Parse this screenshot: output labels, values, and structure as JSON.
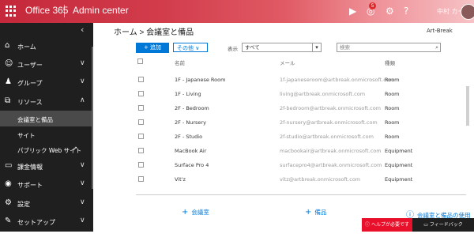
{
  "header": {
    "brand": "Office 365",
    "app_title": "Admin center",
    "notification_count": "5",
    "user_name": "中村 カー"
  },
  "sidebar": {
    "collapse_icon": "chevron-left-icon",
    "items": [
      {
        "label": "ホーム",
        "icon": "home-icon"
      },
      {
        "label": "ユーザー",
        "icon": "person-icon"
      },
      {
        "label": "グループ",
        "icon": "group-icon"
      },
      {
        "label": "リソース",
        "icon": "resources-icon"
      },
      {
        "label": "会議室と備品"
      },
      {
        "label": "サイト"
      },
      {
        "label": "パブリック Web サイト"
      },
      {
        "label": "課金情報",
        "icon": "billing-icon"
      },
      {
        "label": "サポート",
        "icon": "support-icon"
      },
      {
        "label": "設定",
        "icon": "gear-icon"
      },
      {
        "label": "セットアップ",
        "icon": "setup-icon"
      }
    ]
  },
  "page": {
    "title": "ホーム > 会議室と備品",
    "org_name": "Art-Break",
    "add_label": "+ 追加",
    "other_label": "その他 ∨",
    "show_label": "表示",
    "filter_value": "すべて",
    "search_placeholder": "検索"
  },
  "table": {
    "columns": [
      "名前",
      "メール",
      "種類"
    ],
    "rows": [
      {
        "name": "1F - Japanese Room",
        "email": "1f-japaneseroom@artbreak.onmicrosoft.com",
        "type": "Room"
      },
      {
        "name": "1F - Living",
        "email": "living@artbreak.onmicrosoft.com",
        "type": "Room"
      },
      {
        "name": "2F - Bedroom",
        "email": "2f-bedroom@artbreak.onmicrosoft.com",
        "type": "Room"
      },
      {
        "name": "2F - Nursery",
        "email": "2f-nursery@artbreak.onmicrosoft.com",
        "type": "Room"
      },
      {
        "name": "2F - Studio",
        "email": "2f-studio@artbreak.onmicrosoft.com",
        "type": "Room"
      },
      {
        "name": "MacBook Air",
        "email": "macbookair@artbreak.onmicrosoft.com",
        "type": "Equipment"
      },
      {
        "name": "Surface Pro 4",
        "email": "surfacepro4@artbreak.onmicrosoft.com",
        "type": "Equipment"
      },
      {
        "name": "Vit'z",
        "email": "vitz@artbreak.onmicrosoft.com",
        "type": "Equipment"
      }
    ]
  },
  "footer": {
    "add_room": "会議室",
    "add_equipment": "備品",
    "about": "会議室と備品の使用",
    "help": "ヘルプが必要ですか?",
    "feedback": "フィードバック"
  },
  "colors": {
    "accent": "#0078d7",
    "header": "#c4283a",
    "sidebar": "#1f1f1f",
    "help": "#e8102a"
  }
}
